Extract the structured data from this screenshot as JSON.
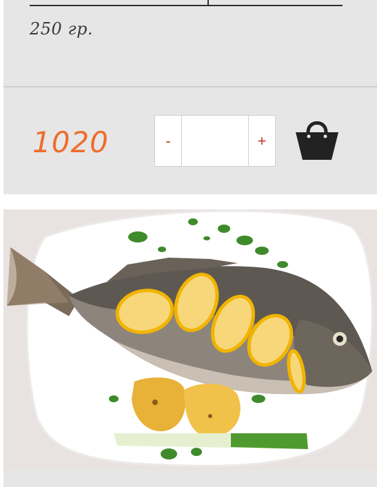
{
  "product": {
    "weight": "250 гр.",
    "price": "1020"
  },
  "quantity": {
    "minus_label": "-",
    "plus_label": "+",
    "value": ""
  },
  "cart": {
    "icon": "shopping-bag-icon"
  },
  "image": {
    "description_name": "product-photo"
  },
  "colors": {
    "price": "#ee6d2b",
    "stepper_sign": "#c0392b",
    "card_bg": "#e6e6e6"
  }
}
